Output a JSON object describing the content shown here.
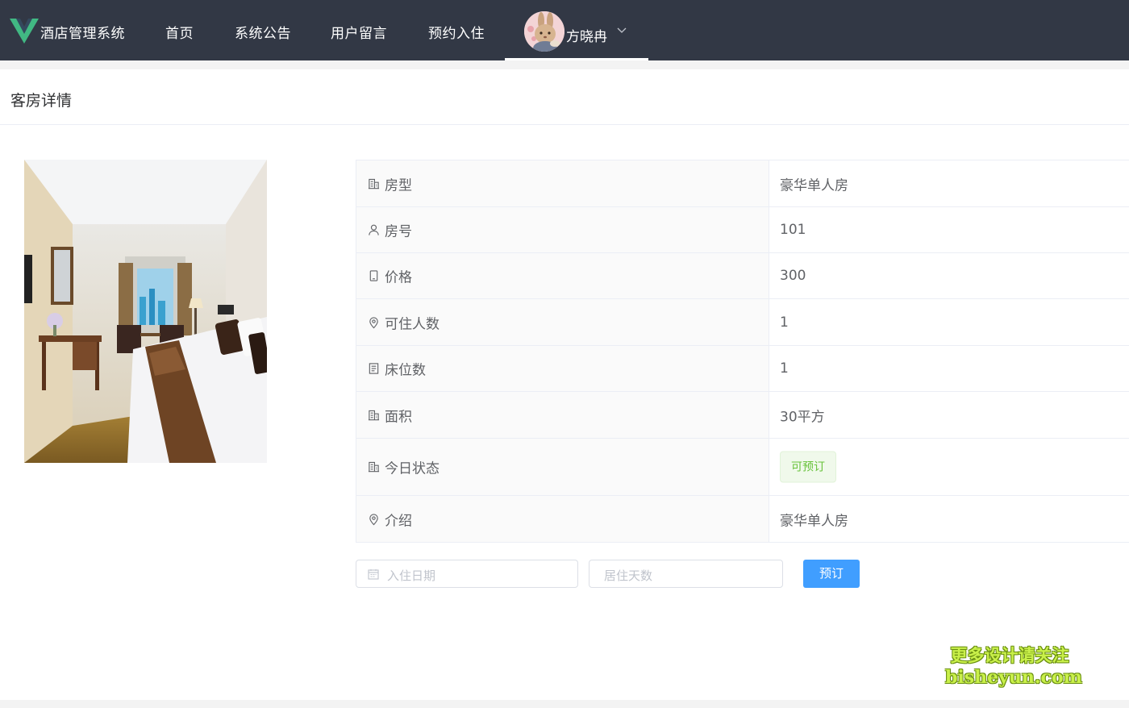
{
  "header": {
    "app_title": "酒店管理系统",
    "nav": [
      {
        "label": "首页"
      },
      {
        "label": "系统公告"
      },
      {
        "label": "用户留言"
      },
      {
        "label": "预约入住"
      }
    ],
    "user": {
      "name": "方晓冉"
    }
  },
  "page": {
    "title": "客房详情"
  },
  "details": [
    {
      "icon": "office-building-icon",
      "label": "房型",
      "value": "豪华单人房"
    },
    {
      "icon": "user-icon",
      "label": "房号",
      "value": "101"
    },
    {
      "icon": "mobile-phone-icon",
      "label": "价格",
      "value": "300"
    },
    {
      "icon": "location-icon",
      "label": "可住人数",
      "value": "1"
    },
    {
      "icon": "document-icon",
      "label": "床位数",
      "value": "1"
    },
    {
      "icon": "office-building-icon",
      "label": "面积",
      "value": "30平方"
    },
    {
      "icon": "office-building-icon",
      "label": "今日状态",
      "tag": "可预订"
    },
    {
      "icon": "location-icon",
      "label": "介绍",
      "value": "豪华单人房"
    }
  ],
  "booking": {
    "date_placeholder": "入住日期",
    "days_placeholder": "居住天数",
    "submit_label": "预订"
  },
  "watermark": {
    "line1": "更多设计请关注",
    "line2": "bisheyun.com"
  },
  "colors": {
    "topbar": "#323845",
    "primary": "#409eff",
    "success": "#67c23a",
    "logo_green": "#41b883"
  }
}
